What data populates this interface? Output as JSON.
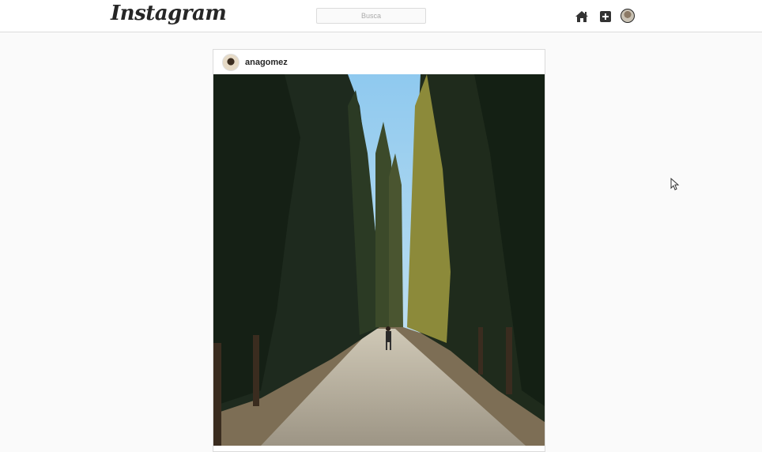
{
  "header": {
    "logo_text": "Instagram",
    "search": {
      "placeholder": "Busca",
      "value": ""
    },
    "icons": [
      "home-icon",
      "add-post-icon",
      "profile-avatar"
    ]
  },
  "post": {
    "username": "anagomez",
    "image_description_icon": "photo"
  },
  "colors": {
    "background": "#fafafa",
    "border": "#dbdbdb",
    "text": "#262626"
  }
}
